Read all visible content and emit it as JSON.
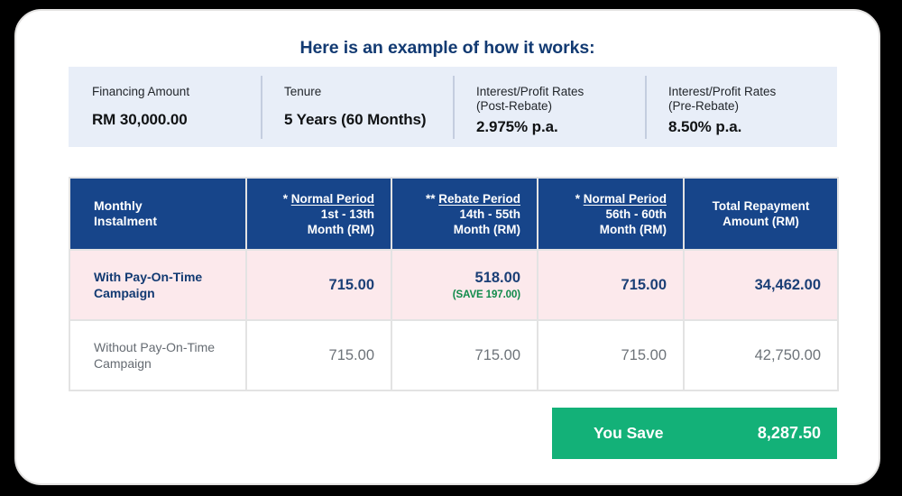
{
  "title": "Here is an example of how it works:",
  "colors": {
    "brand_navy": "#17458a",
    "title_navy": "#123a72",
    "info_bar_bg": "#e8eef8",
    "highlight_row_bg": "#fce9ec",
    "save_green": "#13b178",
    "save_note_green": "#0f8a4a"
  },
  "info_bar": [
    {
      "label": "Financing Amount",
      "label2": "",
      "value": "RM 30,000.00"
    },
    {
      "label": "Tenure",
      "label2": "",
      "value": "5 Years (60 Months)"
    },
    {
      "label": "Interest/Profit Rates",
      "label2": "(Post-Rebate)",
      "value": "2.975% p.a."
    },
    {
      "label": "Interest/Profit Rates",
      "label2": "(Pre-Rebate)",
      "value": "8.50% p.a."
    }
  ],
  "table": {
    "header": {
      "row_label": "Monthly\nInstalment",
      "row_label_line1": "Monthly",
      "row_label_line2": "Instalment",
      "columns": [
        {
          "marker": "* ",
          "period": "Normal Period",
          "range": "1st - 13th",
          "unit": "Month (RM)"
        },
        {
          "marker": "** ",
          "period": "Rebate Period",
          "range": "14th - 55th",
          "unit": "Month (RM)"
        },
        {
          "marker": "* ",
          "period": "Normal Period",
          "range": "56th - 60th",
          "unit": "Month (RM)"
        },
        {
          "marker": "",
          "period": "",
          "range": "Total Repayment",
          "unit": "Amount (RM)"
        }
      ]
    },
    "rows": [
      {
        "label_line1": "With Pay-On-Time",
        "label_line2": "Campaign",
        "normal_1": "715.00",
        "rebate": "518.00",
        "rebate_note": "(SAVE 197.00)",
        "normal_2": "715.00",
        "total": "34,462.00"
      },
      {
        "label_line1": "Without Pay-On-Time",
        "label_line2": "Campaign",
        "normal_1": "715.00",
        "rebate": "715.00",
        "rebate_note": "",
        "normal_2": "715.00",
        "total": "42,750.00"
      }
    ]
  },
  "you_save": {
    "label": "You Save",
    "value": "8,287.50"
  }
}
